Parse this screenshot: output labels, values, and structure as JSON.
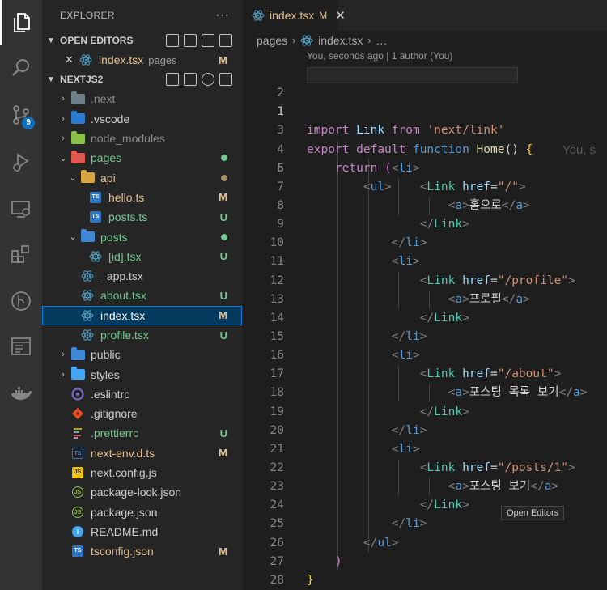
{
  "sidebar": {
    "title": "EXPLORER",
    "more": "···",
    "open_editors": {
      "title": "OPEN EDITORS",
      "items": [
        {
          "close": "✕",
          "name": "index.tsx",
          "folder": "pages",
          "status": "M"
        }
      ]
    },
    "project": {
      "title": "NEXTJS2",
      "items": [
        {
          "label": ".next",
          "twisty": "›",
          "status": ""
        },
        {
          "label": ".vscode",
          "twisty": "›",
          "status": ""
        },
        {
          "label": "node_modules",
          "twisty": "›",
          "status": ""
        },
        {
          "label": "pages",
          "twisty": "⌄",
          "status": ""
        },
        {
          "label": "api",
          "twisty": "⌄",
          "status": ""
        },
        {
          "label": "hello.ts",
          "twisty": "",
          "status": "M"
        },
        {
          "label": "posts.ts",
          "twisty": "",
          "status": "U"
        },
        {
          "label": "posts",
          "twisty": "⌄",
          "status": ""
        },
        {
          "label": "[id].tsx",
          "twisty": "",
          "status": "U"
        },
        {
          "label": "_app.tsx",
          "twisty": "",
          "status": ""
        },
        {
          "label": "about.tsx",
          "twisty": "",
          "status": "U"
        },
        {
          "label": "index.tsx",
          "twisty": "",
          "status": "M"
        },
        {
          "label": "profile.tsx",
          "twisty": "",
          "status": "U"
        },
        {
          "label": "public",
          "twisty": "›",
          "status": ""
        },
        {
          "label": "styles",
          "twisty": "›",
          "status": ""
        },
        {
          "label": ".eslintrc",
          "twisty": "",
          "status": ""
        },
        {
          "label": ".gitignore",
          "twisty": "",
          "status": ""
        },
        {
          "label": ".prettierrc",
          "twisty": "",
          "status": "U"
        },
        {
          "label": "next-env.d.ts",
          "twisty": "",
          "status": "M"
        },
        {
          "label": "next.config.js",
          "twisty": "",
          "status": ""
        },
        {
          "label": "package-lock.json",
          "twisty": "",
          "status": ""
        },
        {
          "label": "package.json",
          "twisty": "",
          "status": ""
        },
        {
          "label": "README.md",
          "twisty": "",
          "status": ""
        },
        {
          "label": "tsconfig.json",
          "twisty": "",
          "status": "M"
        }
      ]
    }
  },
  "activity": {
    "scm_badge": "9"
  },
  "editor": {
    "tab": {
      "name": "index.tsx",
      "status": "M",
      "close": "✕"
    },
    "breadcrumb": [
      "pages",
      "index.tsx",
      "…"
    ],
    "codelens": "You, seconds ago | 1 author (You)",
    "ghost_text": "You, s",
    "tooltip": "Open Editors",
    "line_numbers": [
      "1",
      "2",
      "3",
      "4",
      "5",
      "6",
      "7",
      "8",
      "9",
      "10",
      "11",
      "12",
      "13",
      "14",
      "15",
      "16",
      "17",
      "18",
      "19",
      "20",
      "21",
      "22",
      "23",
      "24",
      "25",
      "26",
      "27",
      "28"
    ],
    "code": {
      "l1": {
        "kw": "import",
        "id": "Link",
        "from": "from",
        "str": "'next/link'"
      },
      "l3": {
        "export": "export",
        "default": "default",
        "function": "function",
        "name": "Home",
        "parens": "()",
        "brace": "{"
      },
      "l4": {
        "ret": "return",
        "paren": "("
      },
      "ul": "ul",
      "li": "li",
      "link": "Link",
      "href": "href",
      "a": "a",
      "links": [
        {
          "href": "\"/\"",
          "text": "홈으로"
        },
        {
          "href": "\"/profile\"",
          "text": "프로필"
        },
        {
          "href": "\"/about\"",
          "text": "포스팅 목록 보기"
        },
        {
          "href": "\"/posts/1\"",
          "text": "포스팅 보기"
        }
      ],
      "l27": ")",
      "l28": "}"
    }
  }
}
